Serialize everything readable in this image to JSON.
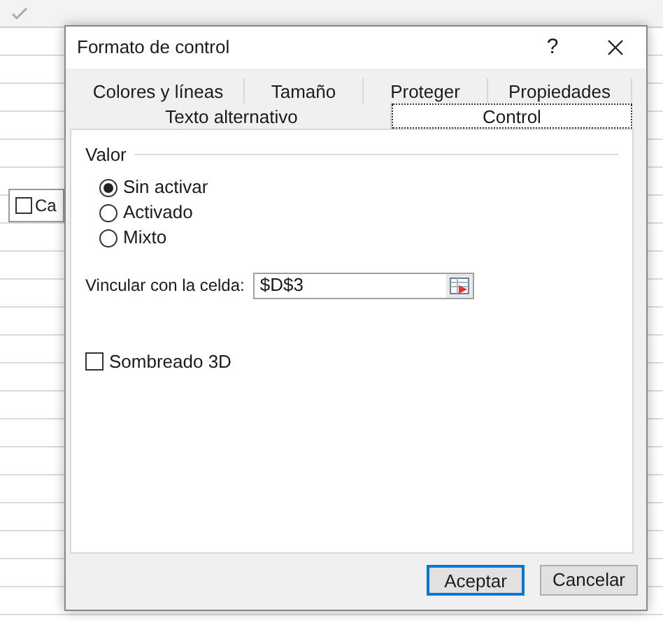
{
  "sheet": {
    "checkbox_label": "Ca",
    "checkbox_checked": false
  },
  "window": {
    "title": "Formato de control",
    "help": "?"
  },
  "tab_rows": [
    [
      {
        "label": "Colores y líneas",
        "selected": false
      },
      {
        "label": "Tamaño",
        "selected": false
      },
      {
        "label": "Proteger",
        "selected": false
      },
      {
        "label": "Propiedades",
        "selected": false
      }
    ],
    [
      {
        "label": "Texto alternativo",
        "selected": false
      },
      {
        "label": "Control",
        "selected": true
      }
    ]
  ],
  "value_group": {
    "title": "Valor",
    "options": [
      {
        "label": "Sin activar",
        "selected": true
      },
      {
        "label": "Activado",
        "selected": false
      },
      {
        "label": "Mixto",
        "selected": false
      }
    ]
  },
  "cell_link": {
    "label": "Vincular con la celda:",
    "value": "$D$3"
  },
  "shading_3d": {
    "label": "Sombreado 3D",
    "checked": false
  },
  "buttons": [
    {
      "label": "Aceptar",
      "default": true
    },
    {
      "label": "Cancelar",
      "default": false
    }
  ]
}
